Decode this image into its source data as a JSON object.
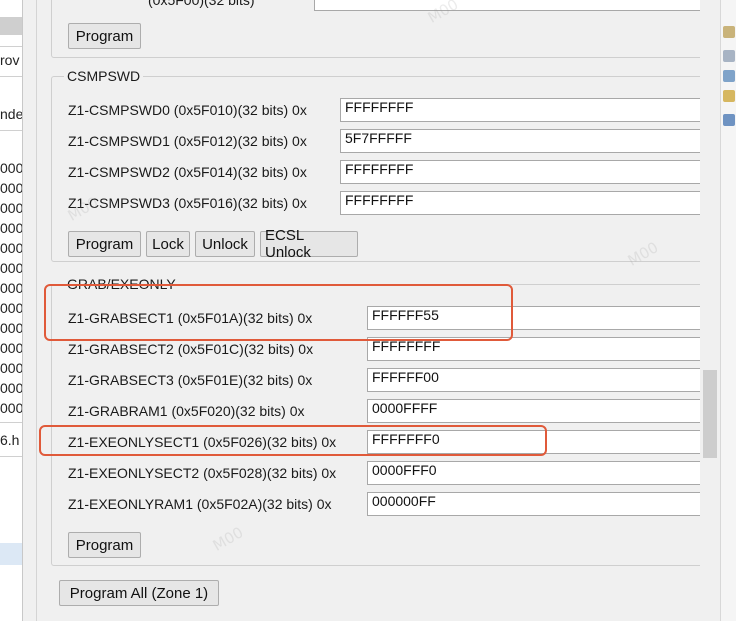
{
  "left_panel": {
    "items": [
      "rov",
      "nde",
      "000",
      "000",
      "000",
      "000",
      "000",
      "000",
      "000",
      "000",
      "000",
      "000",
      "000",
      "000",
      "000",
      "6.h"
    ]
  },
  "top_partial": {
    "label": "(0x5F00)(32 bits)",
    "button": "Program"
  },
  "csmpswd": {
    "title": "CSMPSWD",
    "fields": [
      {
        "label": "Z1-CSMPSWD0 (0x5F010)(32 bits) 0x",
        "value": "FFFFFFFF"
      },
      {
        "label": "Z1-CSMPSWD1 (0x5F012)(32 bits) 0x",
        "value": "5F7FFFFF"
      },
      {
        "label": "Z1-CSMPSWD2 (0x5F014)(32 bits) 0x",
        "value": "FFFFFFFF"
      },
      {
        "label": "Z1-CSMPSWD3 (0x5F016)(32 bits) 0x",
        "value": "FFFFFFFF"
      }
    ],
    "buttons": {
      "program": "Program",
      "lock": "Lock",
      "unlock": "Unlock",
      "ecsl_unlock": "ECSL Unlock"
    }
  },
  "grab": {
    "title": "GRAB/EXEONLY",
    "fields": [
      {
        "label": "Z1-GRABSECT1 (0x5F01A)(32 bits) 0x",
        "value": "FFFFFF55"
      },
      {
        "label": "Z1-GRABSECT2 (0x5F01C)(32 bits) 0x",
        "value": "FFFFFFFF"
      },
      {
        "label": "Z1-GRABSECT3 (0x5F01E)(32 bits) 0x",
        "value": "FFFFFF00"
      },
      {
        "label": "Z1-GRABRAM1 (0x5F020)(32 bits) 0x",
        "value": "0000FFFF"
      },
      {
        "label": "Z1-EXEONLYSECT1 (0x5F026)(32 bits) 0x",
        "value": "FFFFFFF0"
      },
      {
        "label": "Z1-EXEONLYSECT2 (0x5F028)(32 bits) 0x",
        "value": "0000FFF0"
      },
      {
        "label": "Z1-EXEONLYRAM1 (0x5F02A)(32 bits) 0x",
        "value": "000000FF"
      }
    ],
    "buttons": {
      "program": "Program"
    }
  },
  "program_all": "Program All (Zone 1)",
  "colors": {
    "annotation": "#e05a3a",
    "panel": "#f0f0f0",
    "input_bg": "#ffffff"
  }
}
